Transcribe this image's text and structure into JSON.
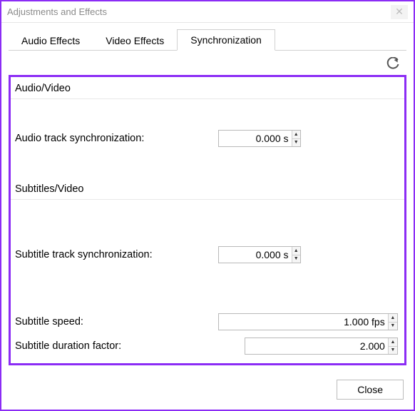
{
  "window": {
    "title": "Adjustments and Effects"
  },
  "tabs": {
    "audio": "Audio Effects",
    "video": "Video Effects",
    "sync": "Synchronization"
  },
  "groups": {
    "av": "Audio/Video",
    "sub": "Subtitles/Video"
  },
  "fields": {
    "audioSync": {
      "label": "Audio track synchronization:",
      "value": "0.000 s"
    },
    "subSync": {
      "label": "Subtitle track synchronization:",
      "value": "0.000 s"
    },
    "subSpeed": {
      "label": "Subtitle speed:",
      "value": "1.000 fps"
    },
    "subDuration": {
      "label": "Subtitle duration factor:",
      "value": "2.000"
    }
  },
  "buttons": {
    "close": "Close"
  }
}
